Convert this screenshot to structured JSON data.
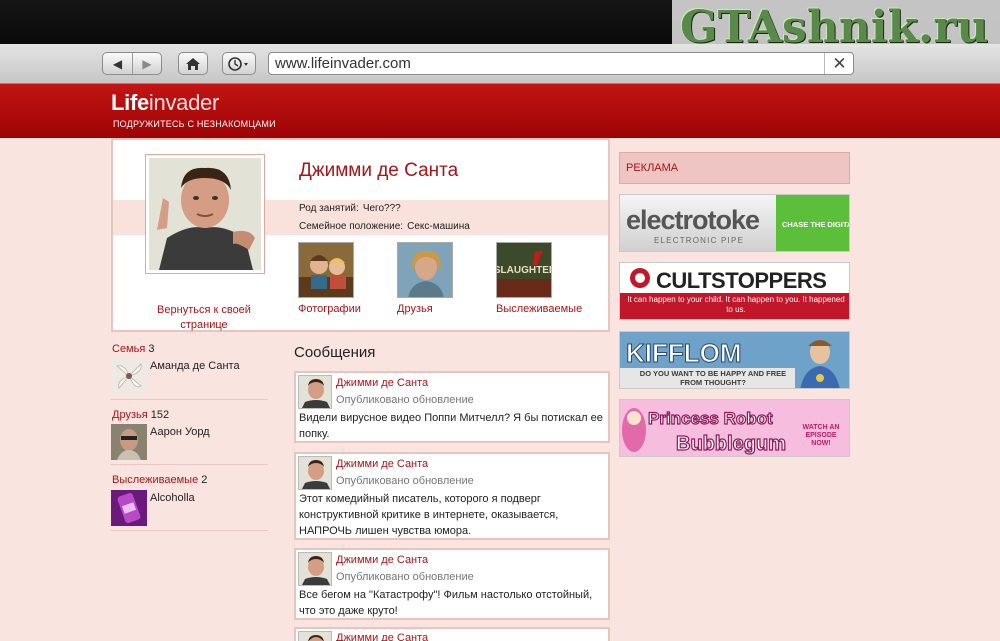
{
  "watermark": "GTAshnik.ru",
  "browser": {
    "url": "www.lifeinvader.com",
    "close_glyph": "✕"
  },
  "site": {
    "logo_bold": "Life",
    "logo_rest": "invader",
    "tagline": "ПОДРУЖИТЕСЬ С НЕЗНАКОМЦАМИ"
  },
  "profile": {
    "name": "Джимми де Санта",
    "occupation_label": "Род занятий:",
    "occupation": "Чего???",
    "marital_label": "Семейное положение:",
    "marital": "Секс-машина",
    "back_link": "Вернуться к своей странице",
    "tiles": [
      {
        "label": "Фотографии"
      },
      {
        "label": "Друзья"
      },
      {
        "label": "Выслеживаемые",
        "tile_text": "SLAUGHTER"
      }
    ]
  },
  "sidebar": {
    "family": {
      "label": "Семья",
      "count": "3",
      "item": "Аманда де Санта"
    },
    "friends": {
      "label": "Друзья",
      "count": "152",
      "item": "Аарон Уорд"
    },
    "stalkers": {
      "label": "Выслеживаемые",
      "count": "2",
      "item": "Alcoholla"
    }
  },
  "messages": {
    "title": "Сообщения",
    "items": [
      {
        "author": "Джимми де Санта",
        "status": "Опубликовано обновление",
        "text": "Видели вирусное видео Поппи Митчелл? Я бы потискал ее попку."
      },
      {
        "author": "Джимми де Санта",
        "status": "Опубликовано обновление",
        "text": "Этот комедийный писатель, которого я подверг конструктивной критике в интернете, оказывается, НАПРОЧЬ лишен чувства юмора."
      },
      {
        "author": "Джимми де Санта",
        "status": "Опубликовано обновление",
        "text": "Все бегом на \"Катастрофу\"! Фильм настолько отстойный, что это даже круто!"
      },
      {
        "author": "Джимми де Санта"
      }
    ]
  },
  "ads": {
    "header": "РЕКЛАМА",
    "electrotoke": {
      "brand": "electrotoke",
      "sub": "ELECTRONIC PIPE",
      "cta": "CHASE THE DIGITAL DRAGON"
    },
    "cultstoppers": {
      "brand": "CULTSTOPPERS",
      "text": "It can happen to your child.  It can happen to you. It happened to us."
    },
    "kifflom": {
      "brand": "KIFFLOM",
      "text": "DO YOU WANT TO BE HAPPY AND FREE FROM THOUGHT?"
    },
    "princess": {
      "line1": "Princess Robot",
      "line2": "Bubblegum",
      "cta": "WATCH AN EPISODE NOW!"
    }
  }
}
